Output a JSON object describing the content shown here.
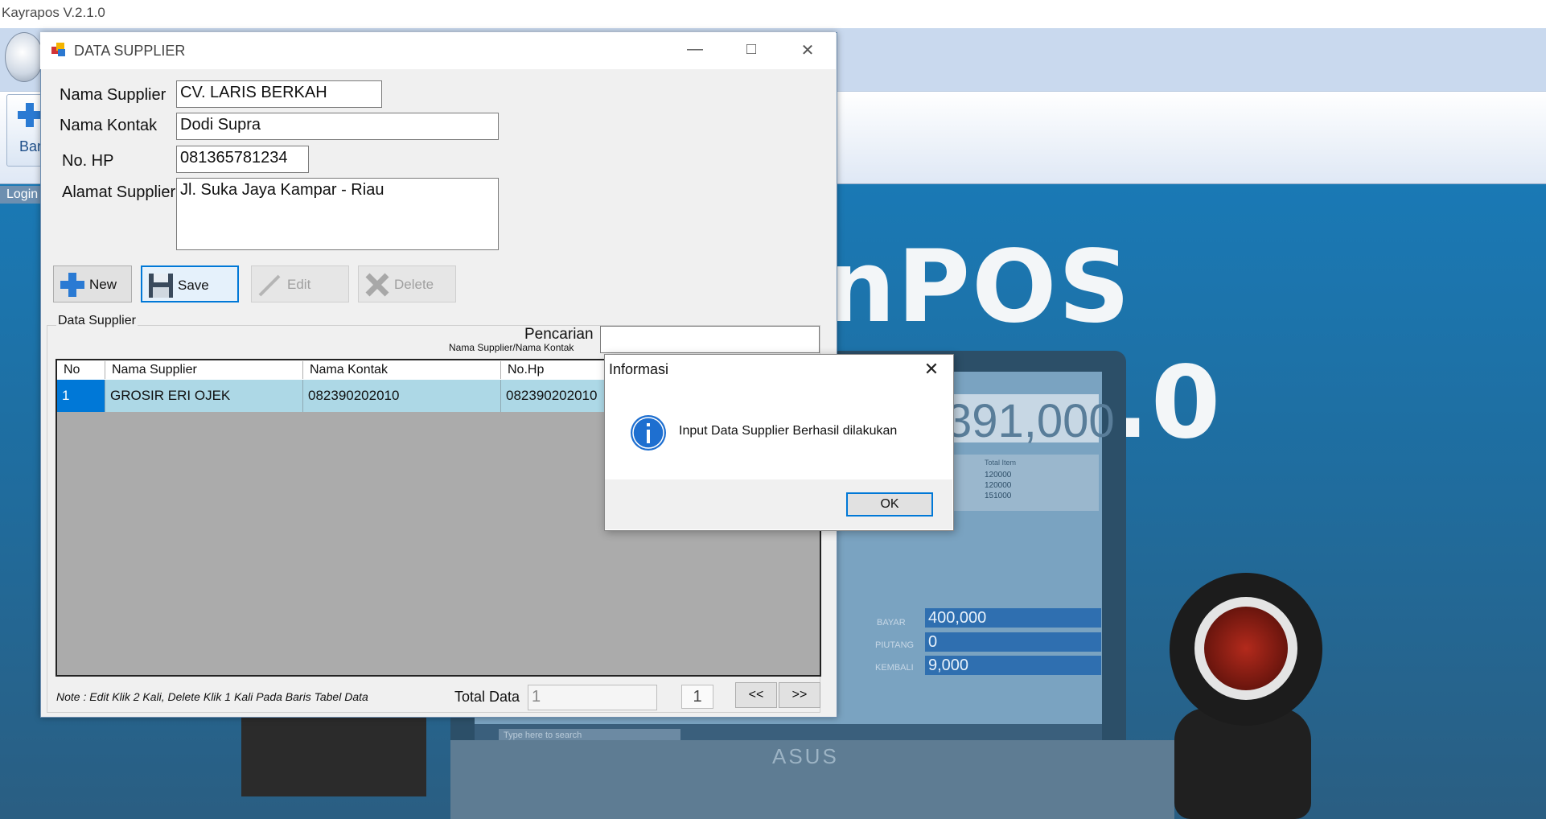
{
  "app": {
    "title": "Kayrapos V.2.1.0",
    "ribbon_button_label": "Bar",
    "login_label": "Login"
  },
  "background": {
    "banner_text": "nPOS V.2.1.0",
    "screen_total": "391,000",
    "table_header": "Total Item",
    "table_values": [
      "120000",
      "120000",
      "151000"
    ],
    "bayar_label": "BAYAR",
    "bayar_value": "400,000",
    "piutang_label": "PIUTANG",
    "piutang_value": "0",
    "kembali_label": "KEMBALI",
    "kembali_value": "9,000",
    "taskbar_search": "Type here to search",
    "laptop_brand": "ASUS"
  },
  "window": {
    "title": "DATA SUPPLIER",
    "form": {
      "nama_supplier_label": "Nama Supplier",
      "nama_supplier_value": "CV. LARIS BERKAH",
      "nama_kontak_label": "Nama Kontak",
      "nama_kontak_value": "Dodi Supra",
      "no_hp_label": "No. HP",
      "no_hp_value": "081365781234",
      "alamat_label": "Alamat Supplier",
      "alamat_value": "Jl. Suka Jaya Kampar - Riau"
    },
    "toolbar": {
      "new": "New",
      "save": "Save",
      "edit": "Edit",
      "delete": "Delete"
    },
    "group_label": "Data Supplier",
    "search": {
      "label": "Pencarian",
      "sublabel": "Nama Supplier/Nama Kontak",
      "value": ""
    },
    "grid": {
      "columns": [
        "No",
        "Nama Supplier",
        "Nama Kontak",
        "No.Hp"
      ],
      "rows": [
        {
          "no": "1",
          "nama_supplier": "GROSIR ERI OJEK",
          "nama_kontak": "082390202010",
          "no_hp": "082390202010"
        }
      ]
    },
    "footer": {
      "note": "Note : Edit Klik 2 Kali, Delete Klik 1 Kali Pada Baris Tabel Data",
      "total_label": "Total Data",
      "total_value": "1",
      "page_value": "1",
      "prev": "<<",
      "next": ">>"
    }
  },
  "dialog": {
    "title": "Informasi",
    "message": "Input Data Supplier Berhasil dilakukan",
    "ok": "OK"
  }
}
